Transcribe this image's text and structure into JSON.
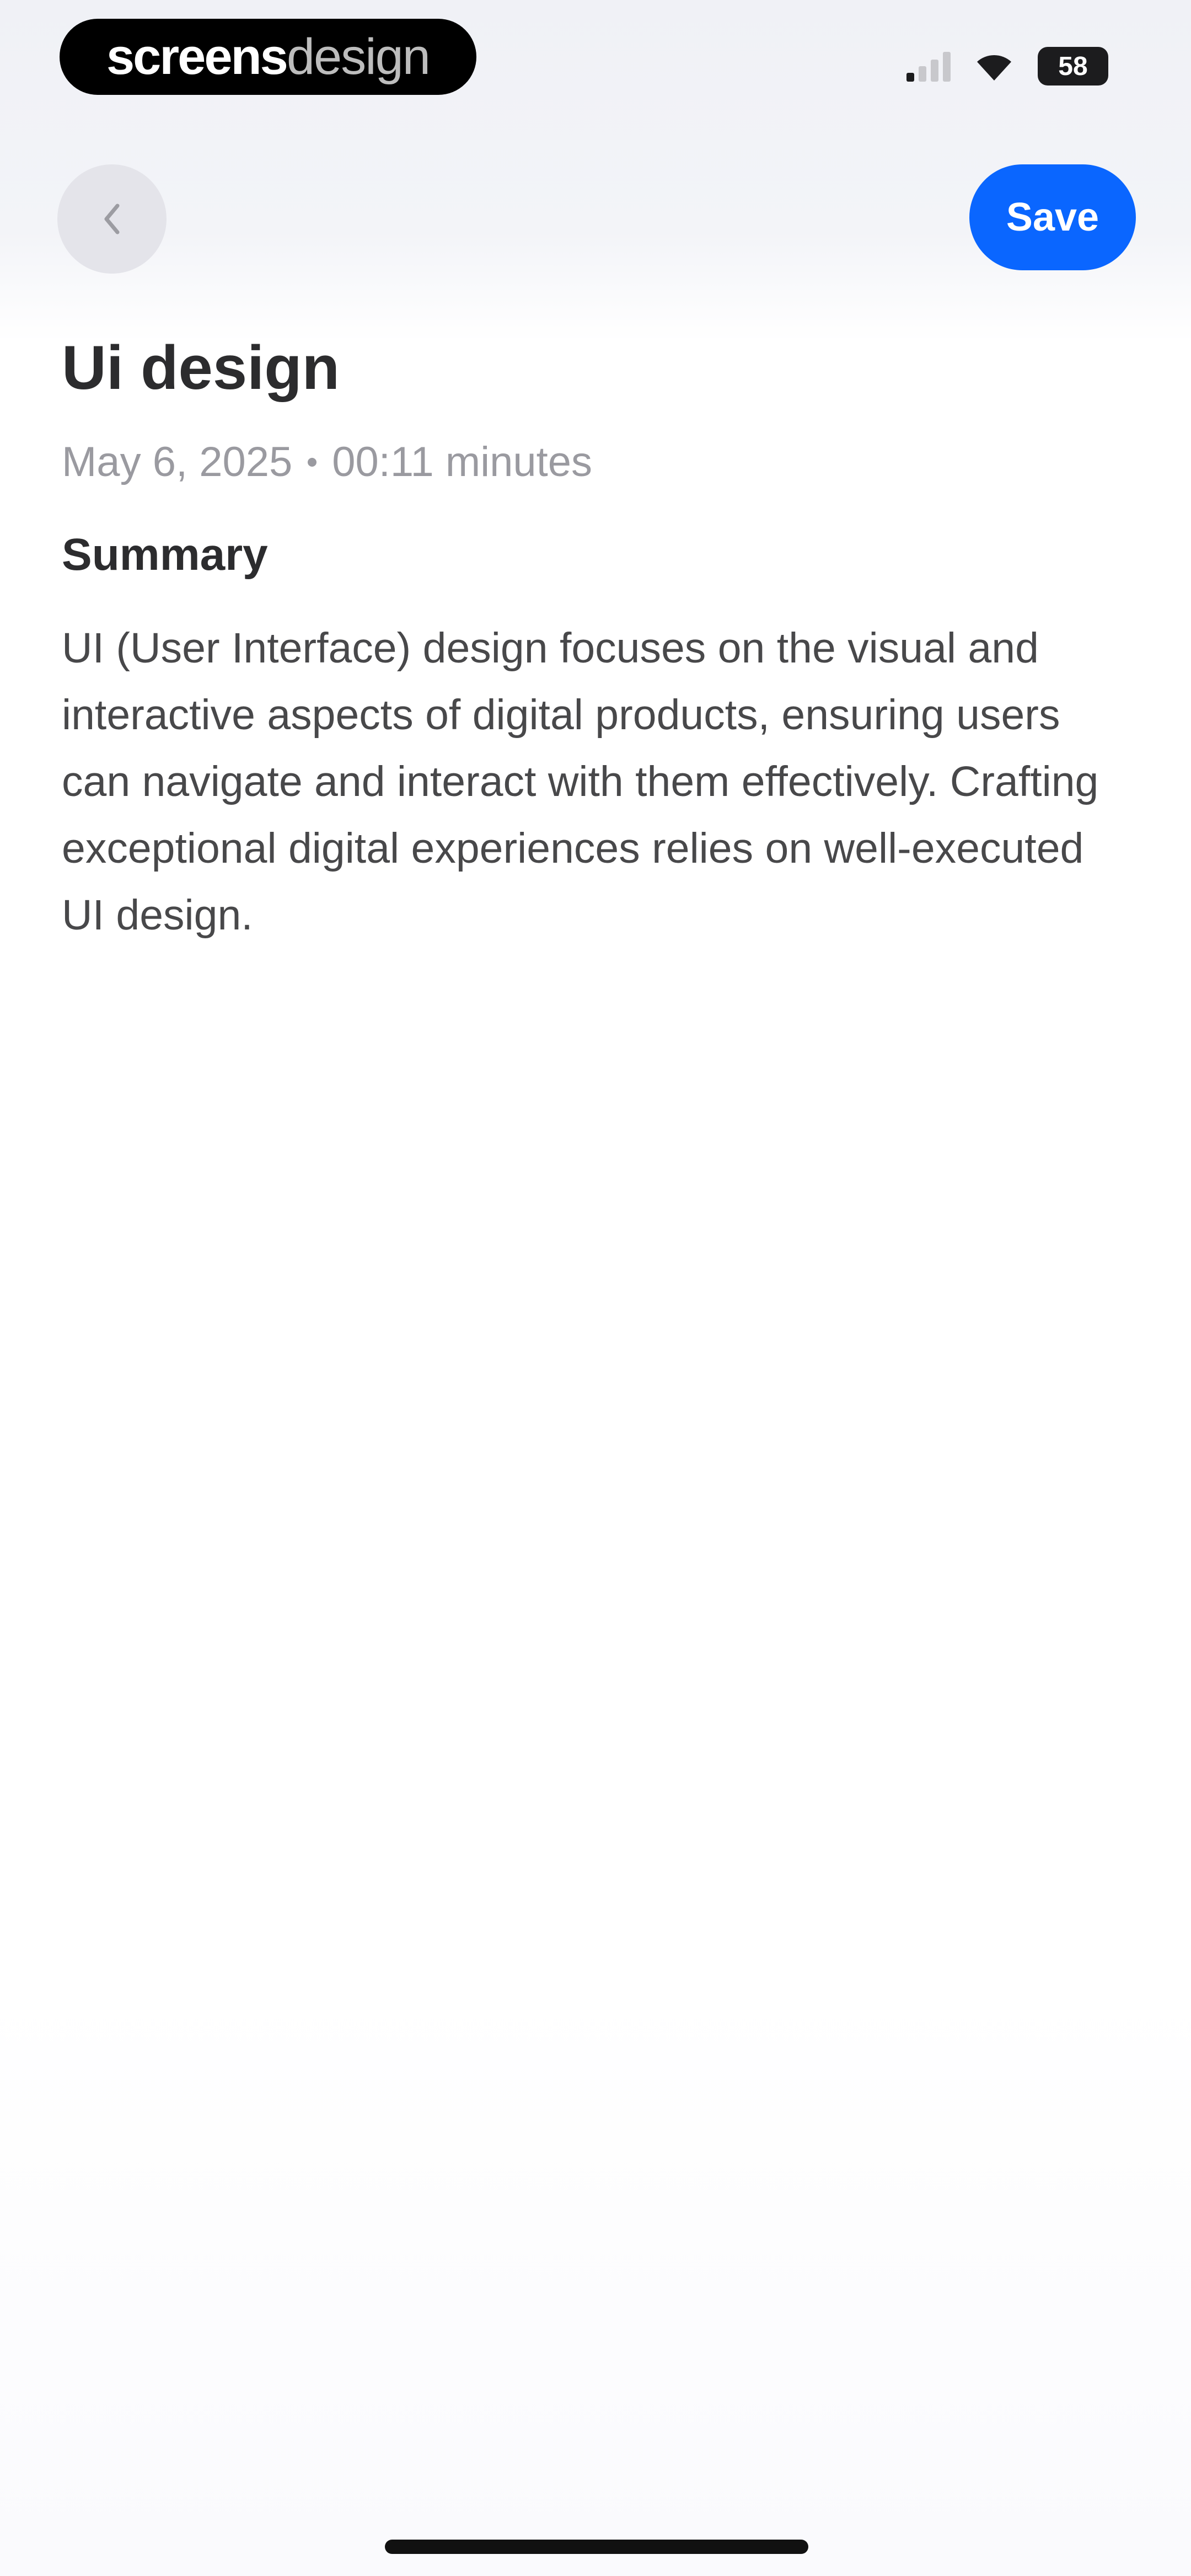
{
  "status_bar": {
    "brand_strong": "screens",
    "brand_light": "design",
    "battery_level": "58",
    "signal_bars_active": 1,
    "signal_bars_total": 4
  },
  "nav": {
    "back_icon": "chevron-left-icon",
    "save_label": "Save"
  },
  "note": {
    "title": "Ui design",
    "date": "May 6, 2025",
    "duration": "00:11 minutes",
    "summary_heading": "Summary",
    "summary_text": "UI (User Interface) design focuses on the visual and interactive aspects of digital products, ensuring users can navigate and interact with them effectively. Crafting exceptional digital experiences relies on well-executed UI design."
  },
  "colors": {
    "accent": "#0a66ff",
    "background": "#ffffff",
    "header_background": "#f0f1f6",
    "title_text": "#2c2c2e",
    "meta_text": "#9a9aa0"
  }
}
